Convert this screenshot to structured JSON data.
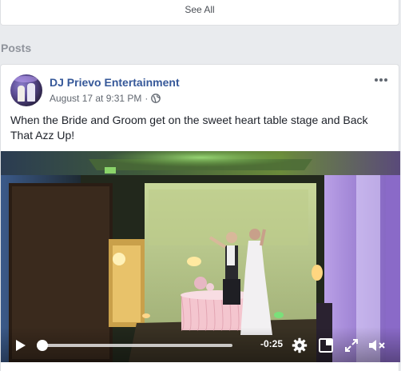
{
  "top_card": {
    "see_all": "See All"
  },
  "section": {
    "title": "Posts"
  },
  "post": {
    "author": "DJ Prievo Entertainment",
    "timestamp": "August 17 at 9:31 PM",
    "separator": "·",
    "audience_icon": "globe-icon",
    "more_icon": "more-options-icon",
    "text": "When the Bride and Groom get on the sweet heart table stage and Back That Azz Up!"
  },
  "video": {
    "remaining_time": "-0:25",
    "progress": 0.01,
    "icons": {
      "play": "play-icon",
      "settings": "gear-icon",
      "popout": "picture-in-picture-icon",
      "fullscreen": "fullscreen-icon",
      "volume": "volume-muted-icon"
    }
  },
  "colors": {
    "link": "#365899",
    "meta": "#616770",
    "background": "#e9ebee",
    "reaction_like": "#1877f2",
    "reaction_love": "#f33e58"
  }
}
